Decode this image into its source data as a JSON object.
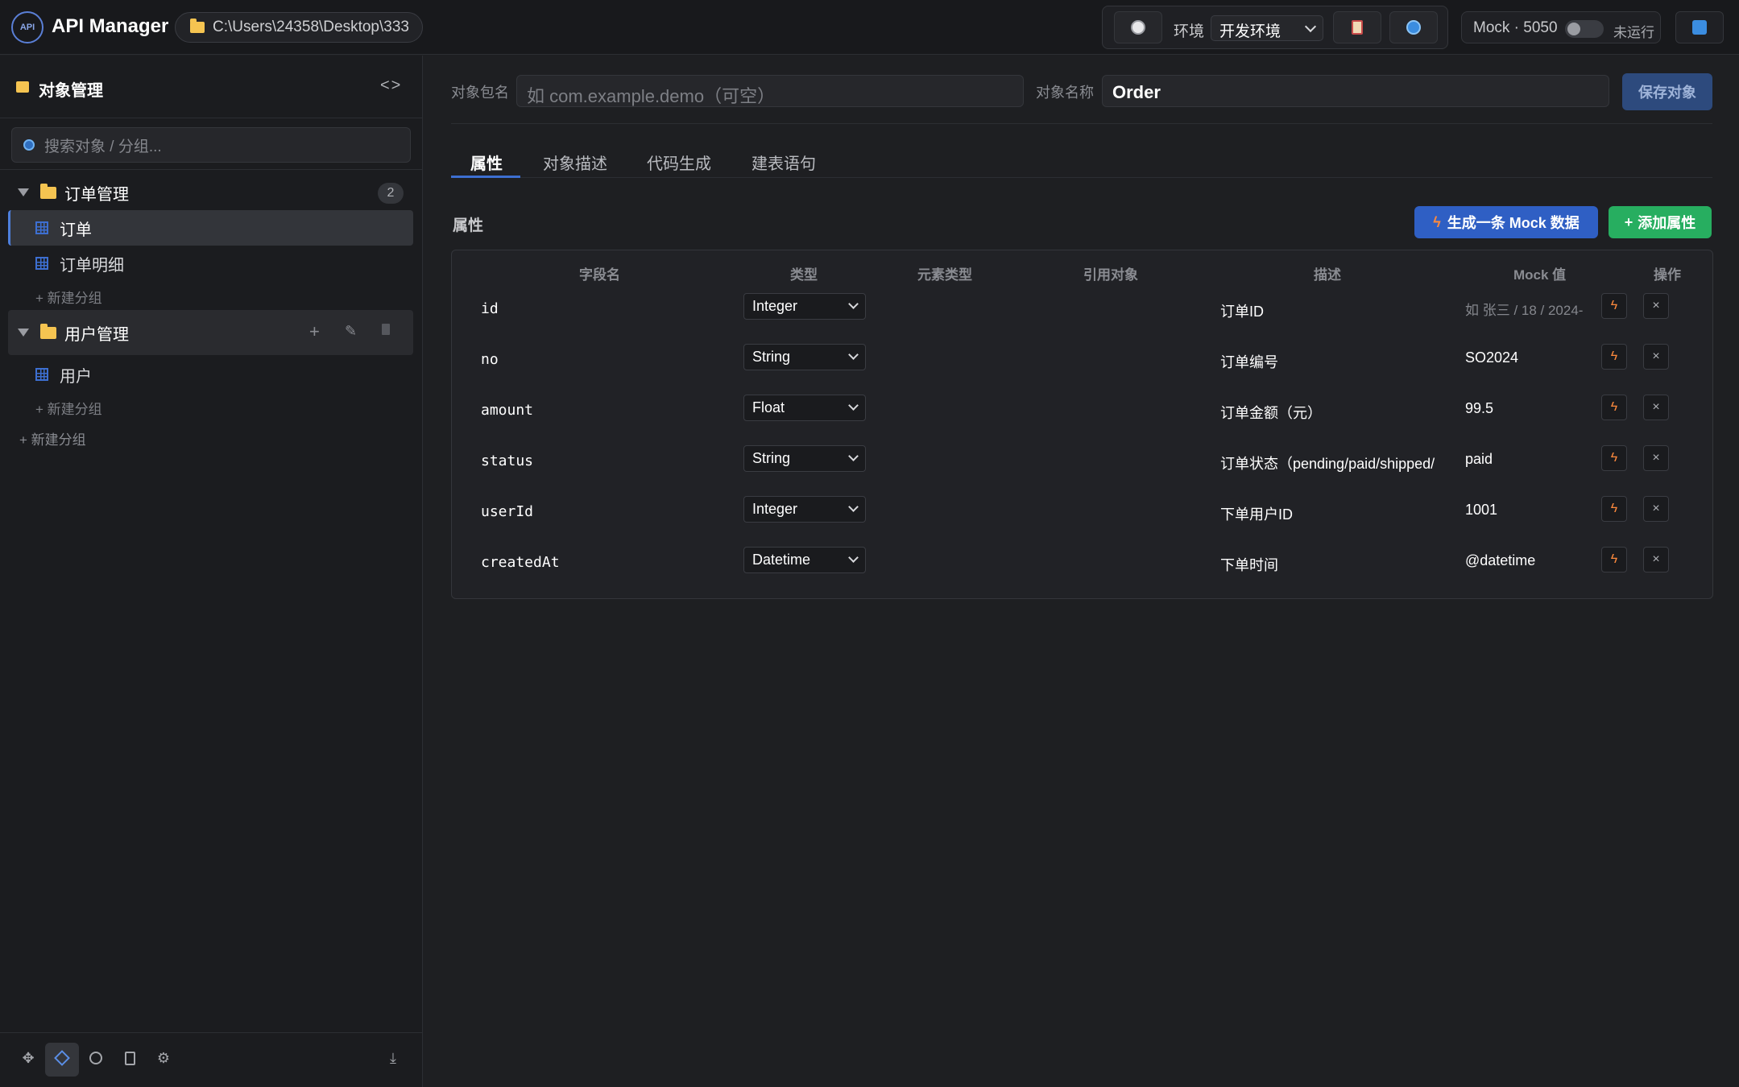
{
  "topbar": {
    "logo_text": "API",
    "app_title": "API Manager",
    "workspace_path": "C:\\Users\\24358\\Desktop\\333",
    "env_label": "环境",
    "env_selected": "开发环境",
    "mock_label": "Mock · 5050",
    "mock_status": "未运行"
  },
  "sidebar": {
    "title": "对象管理",
    "code_toggle": "<>",
    "search_placeholder": "搜索对象 / 分组...",
    "groups": [
      {
        "label": "订单管理",
        "count": "2",
        "items": [
          "订单",
          "订单明细"
        ],
        "new_sub": "+ 新建分组"
      },
      {
        "label": "用户管理",
        "items": [
          "用户"
        ],
        "new_sub": "+ 新建分组"
      }
    ],
    "new_group": "+ 新建分组"
  },
  "main": {
    "package_label": "对象包名",
    "package_placeholder": "如 com.example.demo（可空）",
    "name_label": "对象名称",
    "name_value": "Order",
    "save_label": "保存对象",
    "tabs": [
      "属性",
      "对象描述",
      "代码生成",
      "建表语句"
    ],
    "section_title": "属性",
    "gen_mock_label": "生成一条 Mock 数据",
    "add_prop_label": "添加属性",
    "columns": [
      "字段名",
      "类型",
      "元素类型",
      "引用对象",
      "描述",
      "Mock 值",
      "操作"
    ],
    "rows": [
      {
        "name": "id",
        "type": "Integer",
        "desc": "订单ID",
        "mock": "",
        "mock_placeholder": "如 张三 / 18 / 2024-"
      },
      {
        "name": "no",
        "type": "String",
        "desc": "订单编号",
        "mock": "SO2024"
      },
      {
        "name": "amount",
        "type": "Float",
        "desc": "订单金额（元）",
        "mock": "99.5"
      },
      {
        "name": "status",
        "type": "String",
        "desc": "订单状态（pending/paid/shipped/",
        "mock": "paid"
      },
      {
        "name": "userId",
        "type": "Integer",
        "desc": "下单用户ID",
        "mock": "1001"
      },
      {
        "name": "createdAt",
        "type": "Datetime",
        "desc": "下单时间",
        "mock": "@datetime"
      }
    ]
  },
  "icons": {
    "history": "clock-icon",
    "clipboard": "clipboard-icon",
    "globe": "globe-icon",
    "sync": "sync-icon"
  }
}
